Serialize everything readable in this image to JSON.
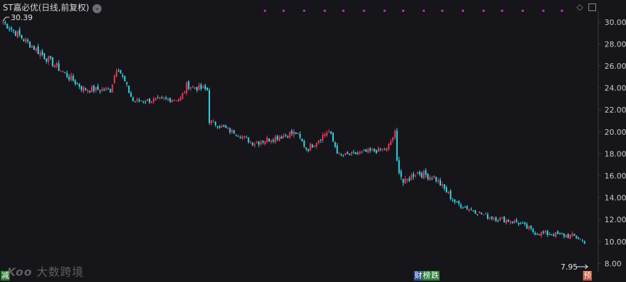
{
  "header": {
    "title": "ST嘉必优(日线,前复权)",
    "chevron_icon": "chevron-down-icon"
  },
  "toolbar": {
    "icons": [
      "diamond-icon",
      "panel-icon"
    ]
  },
  "colors": {
    "up": "#e8375a",
    "down": "#35d1e0",
    "background": "#161519",
    "event_marker": "#c428d8"
  },
  "watermark": {
    "logo": "Koo",
    "text": "大数跨境"
  },
  "badges": {
    "left": "减",
    "cai": "财",
    "bang": "榜",
    "die": "跌",
    "yu": "预"
  },
  "chart_data": {
    "type": "candlestick",
    "title": "ST嘉必优(日线,前复权)",
    "ylim": [
      7.2,
      31.0
    ],
    "y_ticks": [
      "30.00",
      "28.00",
      "26.00",
      "24.00",
      "22.00",
      "20.00",
      "18.00",
      "16.00",
      "14.00",
      "12.00",
      "10.00",
      "8.00"
    ],
    "grid": false,
    "annotations": {
      "high_label": "30.39",
      "low_label": "7.95"
    },
    "event_markers": 16,
    "segments": [
      {
        "from": 30.0,
        "to": 23.9,
        "bars": 40,
        "noise": 0.35
      },
      {
        "from": 23.9,
        "to": 23.8,
        "bars": 12,
        "noise": 0.3
      },
      {
        "from": 23.8,
        "to": 25.8,
        "bars": 4,
        "noise": 0.3
      },
      {
        "from": 25.8,
        "to": 22.8,
        "bars": 8,
        "noise": 0.3
      },
      {
        "from": 22.8,
        "to": 23.0,
        "bars": 22,
        "noise": 0.25
      },
      {
        "from": 23.0,
        "to": 24.2,
        "bars": 4,
        "noise": 0.3
      },
      {
        "from": 24.2,
        "to": 23.8,
        "bars": 10,
        "noise": 0.3
      },
      {
        "from": 21.0,
        "to": 20.0,
        "bars": 12,
        "noise": 0.25
      },
      {
        "from": 20.0,
        "to": 19.0,
        "bars": 10,
        "noise": 0.25
      },
      {
        "from": 19.0,
        "to": 19.9,
        "bars": 20,
        "noise": 0.3
      },
      {
        "from": 19.9,
        "to": 18.5,
        "bars": 6,
        "noise": 0.3
      },
      {
        "from": 18.5,
        "to": 20.0,
        "bars": 10,
        "noise": 0.3
      },
      {
        "from": 20.0,
        "to": 17.8,
        "bars": 6,
        "noise": 0.3
      },
      {
        "from": 17.8,
        "to": 18.4,
        "bars": 22,
        "noise": 0.25
      },
      {
        "from": 18.4,
        "to": 19.9,
        "bars": 5,
        "noise": 0.25
      },
      {
        "from": 17.2,
        "to": 15.4,
        "bars": 4,
        "noise": 0.4
      },
      {
        "from": 15.4,
        "to": 16.3,
        "bars": 6,
        "noise": 0.35
      },
      {
        "from": 16.3,
        "to": 15.9,
        "bars": 8,
        "noise": 0.35
      },
      {
        "from": 15.9,
        "to": 13.4,
        "bars": 12,
        "noise": 0.3
      },
      {
        "from": 13.4,
        "to": 12.2,
        "bars": 16,
        "noise": 0.25
      },
      {
        "from": 12.2,
        "to": 11.8,
        "bars": 12,
        "noise": 0.25
      },
      {
        "from": 11.8,
        "to": 10.8,
        "bars": 10,
        "noise": 0.25
      },
      {
        "from": 10.8,
        "to": 10.5,
        "bars": 18,
        "noise": 0.25
      },
      {
        "from": 10.5,
        "to": 9.95,
        "bars": 6,
        "noise": 0.2
      }
    ]
  }
}
